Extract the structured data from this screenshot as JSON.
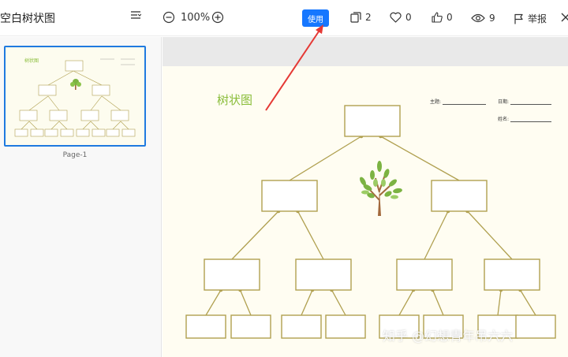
{
  "header": {
    "title": "空白树状图",
    "zoom": "100%",
    "use_label": "使用",
    "copies_count": "2",
    "likes_count": "0",
    "thumbs_count": "0",
    "views_count": "9",
    "report_label": "举报"
  },
  "sidebar": {
    "page_label": "Page-1",
    "thumb_title": "树状图"
  },
  "document": {
    "title": "树状图",
    "theme_label": "主题:",
    "date_label": "日期:",
    "name_label": "姓名:"
  },
  "watermark": "知乎 @幻想青年吊六六",
  "colors": {
    "accent": "#1677ff",
    "tree_line": "#b0a050",
    "title_green": "#8abd3a",
    "paper": "#fffdf2"
  }
}
